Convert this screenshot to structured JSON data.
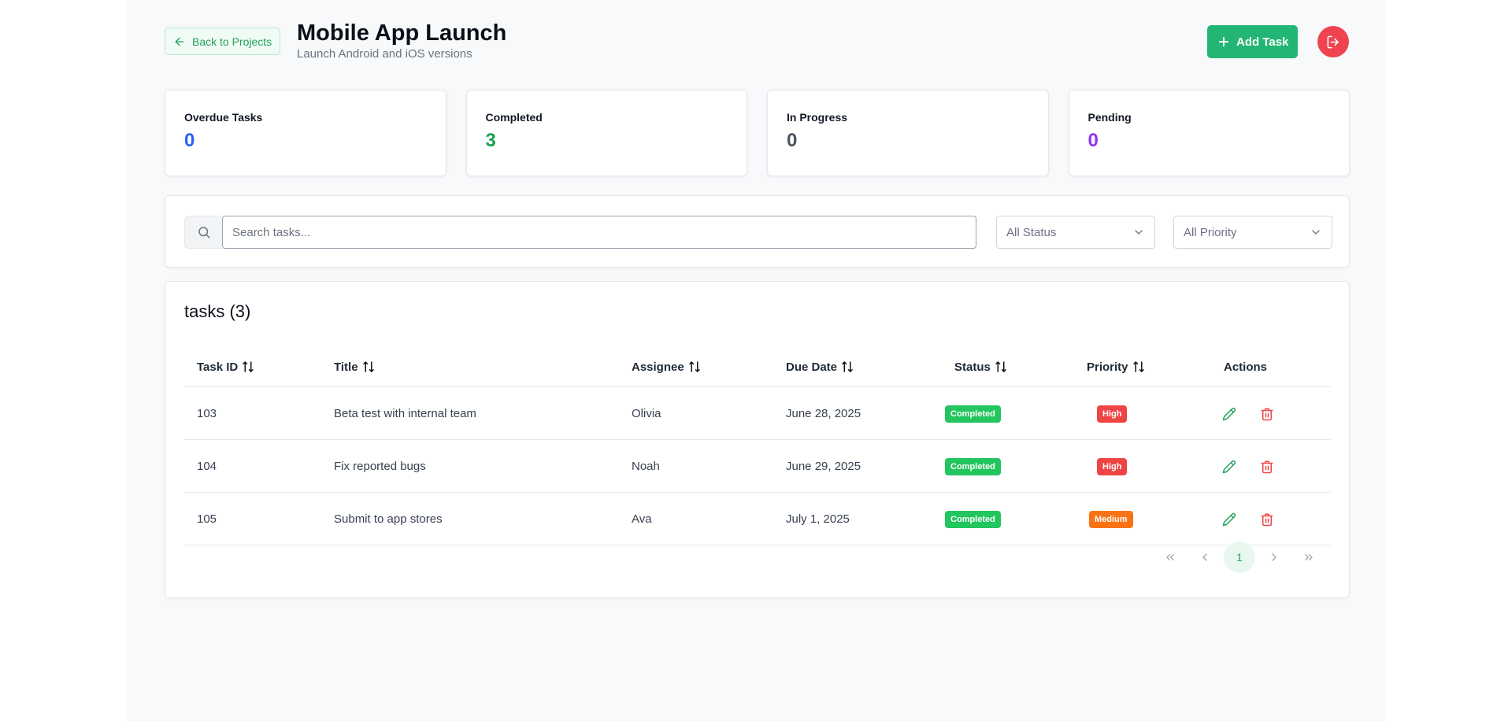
{
  "header": {
    "back_label": "Back to Projects",
    "title": "Mobile App Launch",
    "subtitle": "Launch Android and iOS versions",
    "add_label": "Add Task"
  },
  "stats": [
    {
      "label": "Overdue Tasks",
      "value": "0",
      "color": "#2563eb"
    },
    {
      "label": "Completed",
      "value": "3",
      "color": "#16a34a"
    },
    {
      "label": "In Progress",
      "value": "0",
      "color": "#4b5563"
    },
    {
      "label": "Pending",
      "value": "0",
      "color": "#9333ea"
    }
  ],
  "filters": {
    "search_placeholder": "Search tasks...",
    "status_value": "All Status",
    "priority_value": "All Priority"
  },
  "table": {
    "title": "tasks (3)",
    "columns": [
      "Task ID",
      "Title",
      "Assignee",
      "Due Date",
      "Status",
      "Priority",
      "Actions"
    ],
    "rows": [
      {
        "id": "103",
        "title": "Beta test with internal team",
        "assignee": "Olivia",
        "due": "June 28, 2025",
        "status": "Completed",
        "priority": "High"
      },
      {
        "id": "104",
        "title": "Fix reported bugs",
        "assignee": "Noah",
        "due": "June 29, 2025",
        "status": "Completed",
        "priority": "High"
      },
      {
        "id": "105",
        "title": "Submit to app stores",
        "assignee": "Ava",
        "due": "July 1, 2025",
        "status": "Completed",
        "priority": "Medium"
      }
    ]
  },
  "pagination": {
    "current_page": "1"
  },
  "colors": {
    "accent": "#22b573",
    "danger": "#ef4350",
    "status_completed": "#22c55e",
    "priority_high": "#ef4444",
    "priority_medium": "#f97316"
  },
  "icons": [
    "arrow-left-icon",
    "plus-icon",
    "logout-icon",
    "search-icon",
    "chevron-down-icon",
    "sort-icon",
    "pencil-icon",
    "trash-icon",
    "chevrons-left-icon",
    "chevron-left-icon",
    "chevron-right-icon",
    "chevrons-right-icon"
  ]
}
